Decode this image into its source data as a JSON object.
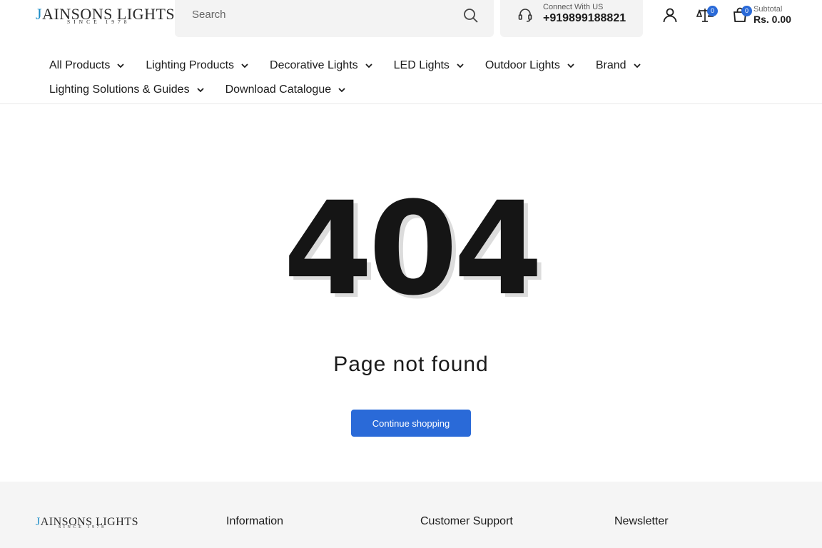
{
  "brand": {
    "logo_initial": "J",
    "logo_rest": "AINSONS LIGHTS",
    "tagline": "SINCE 1978",
    "accent_color": "#1c8dc7"
  },
  "header": {
    "search": {
      "placeholder": "Search",
      "icon": "search-icon"
    },
    "connect": {
      "label": "Connect With US",
      "phone": "+919899188821",
      "icon": "headset-icon"
    },
    "account_icon": "user-icon",
    "compare": {
      "icon": "compare-icon",
      "count": "0"
    },
    "cart": {
      "icon": "cart-icon",
      "count": "0",
      "subtotal_label": "Subtotal",
      "subtotal_value": "Rs. 0.00"
    },
    "badge_color": "#2a6ad8"
  },
  "nav": {
    "row1": [
      {
        "label": "All Products"
      },
      {
        "label": "Lighting Products"
      },
      {
        "label": "Decorative Lights"
      },
      {
        "label": "LED Lights"
      },
      {
        "label": "Outdoor Lights"
      },
      {
        "label": "Brand"
      }
    ],
    "row2": [
      {
        "label": "Lighting Solutions & Guides"
      },
      {
        "label": "Download Catalogue"
      }
    ]
  },
  "main": {
    "error_code": "404",
    "message": "Page not found",
    "button_label": "Continue shopping",
    "button_color": "#2a6ad8"
  },
  "footer": {
    "headings": [
      "Information",
      "Customer Support",
      "Newsletter"
    ]
  }
}
